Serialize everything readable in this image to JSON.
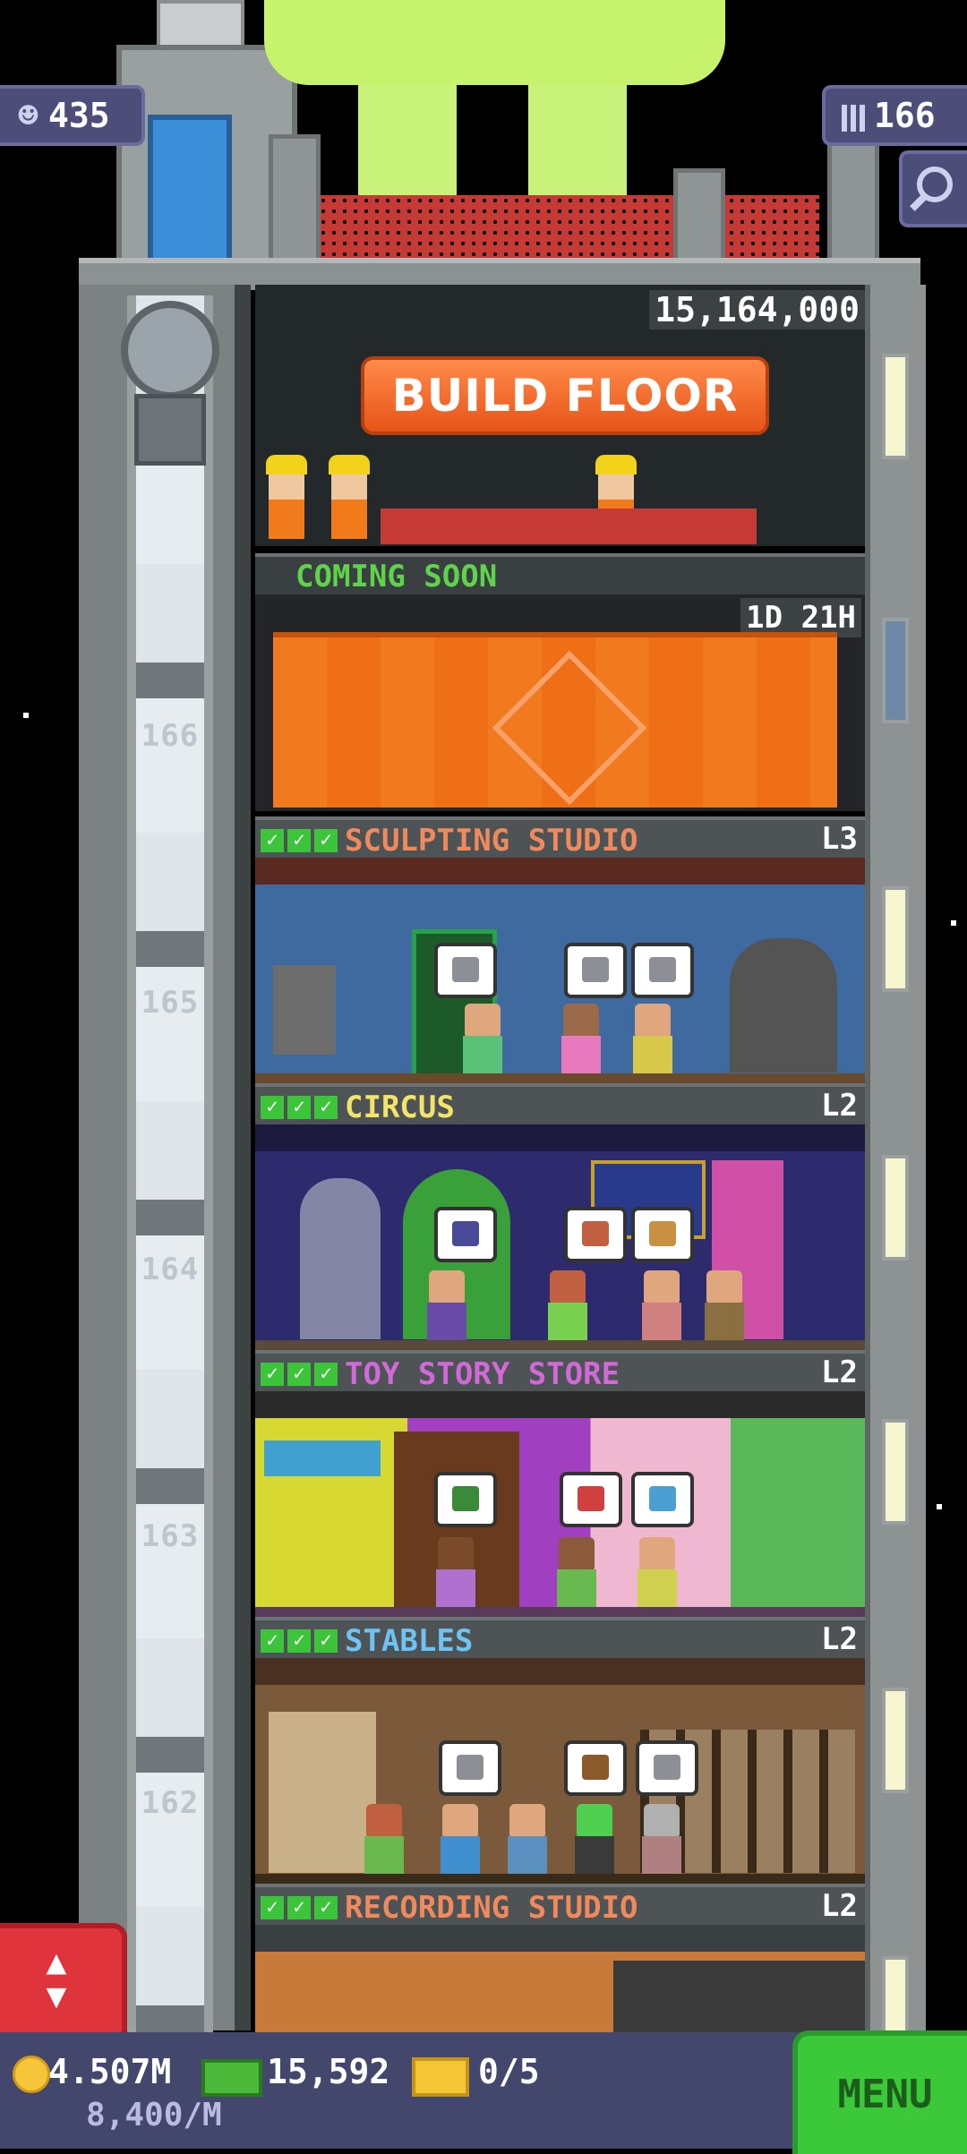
{
  "hud": {
    "population": "435",
    "floors": "166",
    "colors": {
      "badge_bg": "#4d4d7a",
      "menu_green": "#3bc93a",
      "scroll_red": "#e0343d"
    }
  },
  "build": {
    "cost": "15,164,000",
    "button_label": "BUILD FLOOR"
  },
  "construction": {
    "label": "COMING SOON",
    "timer": "1D 21H"
  },
  "floors": [
    {
      "number": "166",
      "name": "SCULPTING STUDIO",
      "level": "L3",
      "name_color": "#f08a5d"
    },
    {
      "number": "165",
      "name": "CIRCUS",
      "level": "L2",
      "name_color": "#f2e36a"
    },
    {
      "number": "164",
      "name": "TOY STORY STORE",
      "level": "L2",
      "name_color": "#d16ad8"
    },
    {
      "number": "163",
      "name": "STABLES",
      "level": "L2",
      "name_color": "#6ec3f2"
    },
    {
      "number": "162",
      "name": "RECORDING STUDIO",
      "level": "L2",
      "name_color": "#f08a5d"
    }
  ],
  "bottom": {
    "coins": "4.507M",
    "income": "8,400/M",
    "bux": "15,592",
    "tickets": "0/5",
    "menu_label": "MENU"
  },
  "icons": [
    "person-icon",
    "building-icon",
    "search-icon",
    "coin-icon",
    "bux-icon",
    "ticket-icon",
    "elevator-arrows-icon",
    "check-icon"
  ]
}
